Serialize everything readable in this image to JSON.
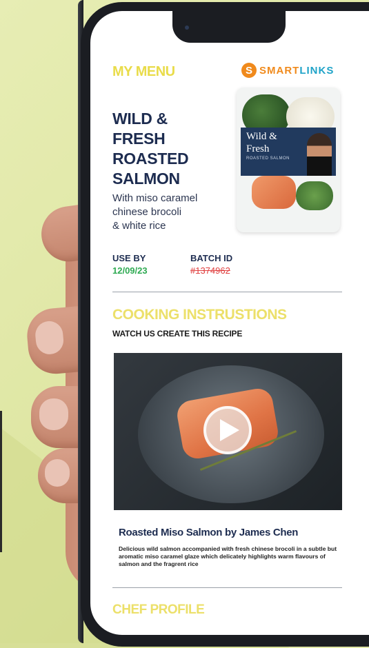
{
  "app": {
    "section_label": "MY MENU",
    "brand": {
      "mark": "S",
      "name_part1": "SMART",
      "name_part2": "LINKS",
      "color_orange": "#f08a1c",
      "color_blue": "#1fa3c8"
    }
  },
  "product": {
    "title_lines": [
      "WILD &",
      "FRESH",
      "ROASTED",
      "SALMON"
    ],
    "subtitle_lines": [
      "With miso caramel",
      "chinese brocoli",
      "& white rice"
    ],
    "pack": {
      "brand_line1": "Wild &",
      "brand_line2": "Fresh",
      "pack_subtitle": "ROASTED SALMON"
    }
  },
  "meta": {
    "use_by_label": "USE BY",
    "use_by_value": "12/09/23",
    "batch_label": "BATCH ID",
    "batch_value": "#1374962"
  },
  "cooking": {
    "heading": "COOKING INSTRUSTIONS",
    "subheading": "WATCH US CREATE THIS RECIPE",
    "video": {
      "play_icon": "play-icon"
    },
    "video_title": "Roasted Miso Salmon by James Chen",
    "description": "Delicious wild salmon accompanied with fresh chinese brocoli in a subtle but aromatic miso caramel glaze which delicately highlights warm flavours of salmon and the fragrent rice"
  },
  "chef": {
    "heading": "CHEF PROFILE"
  },
  "colors": {
    "accent_yellow": "#ece06a",
    "navy": "#1d2c50",
    "green": "#2eaa52",
    "red": "#e04040"
  }
}
